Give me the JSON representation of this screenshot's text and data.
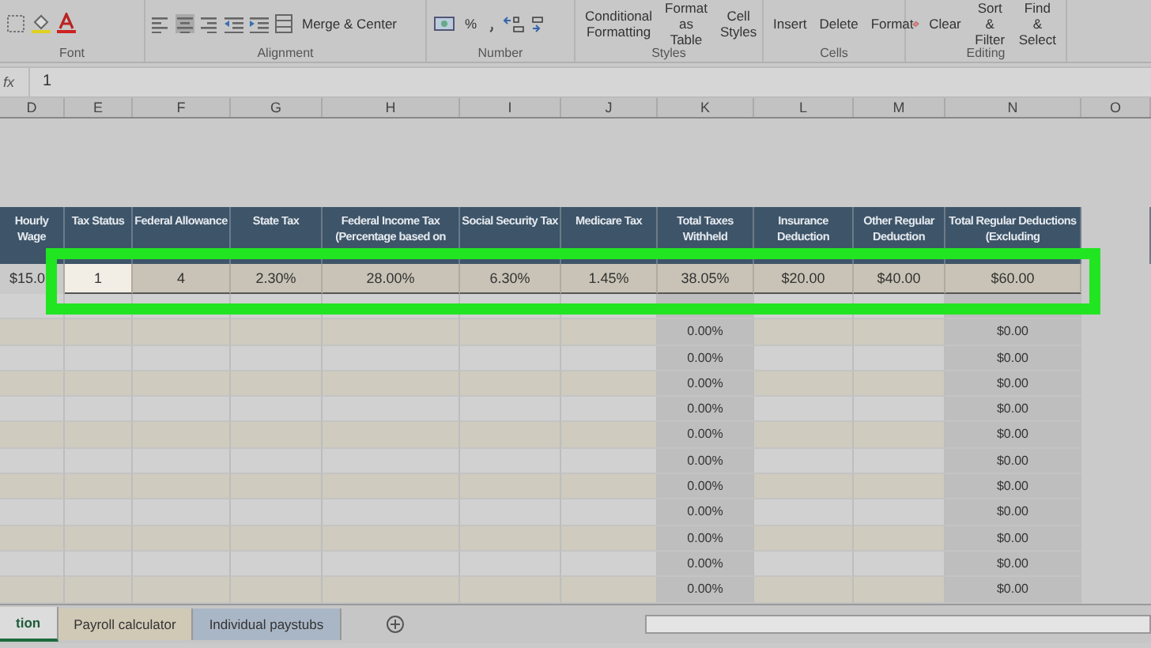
{
  "ribbon": {
    "groups": [
      {
        "kind": "font",
        "label": "Font"
      },
      {
        "kind": "alignment",
        "label": "Alignment",
        "commands": [
          "Merge & Center"
        ]
      },
      {
        "kind": "number",
        "label": "Number",
        "commands": [
          "%"
        ]
      },
      {
        "kind": "styles",
        "label": "Styles",
        "commands": [
          "Conditional Formatting",
          "Format as Table",
          "Cell Styles"
        ]
      },
      {
        "kind": "cells",
        "label": "Cells",
        "commands": [
          "Insert",
          "Delete",
          "Format"
        ]
      },
      {
        "kind": "editing",
        "label": "Editing",
        "commands": [
          "Clear",
          "Sort & Filter",
          "Find & Select"
        ]
      }
    ]
  },
  "formula_bar": {
    "fx": "fx",
    "value": "1"
  },
  "columns": [
    {
      "letter": "D",
      "heading": "Hourly Wage"
    },
    {
      "letter": "E",
      "heading": "Tax Status"
    },
    {
      "letter": "F",
      "heading": "Federal Allowance"
    },
    {
      "letter": "G",
      "heading": "State Tax"
    },
    {
      "letter": "H",
      "heading": "Federal Income Tax (Percentage based on"
    },
    {
      "letter": "I",
      "heading": "Social Security Tax"
    },
    {
      "letter": "J",
      "heading": "Medicare Tax"
    },
    {
      "letter": "K",
      "heading": "Total Taxes Withheld"
    },
    {
      "letter": "L",
      "heading": "Insurance Deduction"
    },
    {
      "letter": "M",
      "heading": "Other Regular Deduction"
    },
    {
      "letter": "N",
      "heading": "Total Regular Deductions (Excluding"
    },
    {
      "letter": "O"
    }
  ],
  "data_row": {
    "cells": [
      {
        "text": "$15.0",
        "selected": false
      },
      {
        "text": "1",
        "selected": true
      },
      {
        "text": "4",
        "selected": false
      },
      {
        "text": "2.30%",
        "selected": false
      },
      {
        "text": "28.00%",
        "selected": false
      },
      {
        "text": "6.30%",
        "selected": false
      },
      {
        "text": "1.45%",
        "selected": false
      },
      {
        "text": "38.05%",
        "selected": false
      },
      {
        "text": "$20.00",
        "selected": false
      },
      {
        "text": "$40.00",
        "selected": false
      },
      {
        "text": "$60.00",
        "selected": false
      }
    ]
  },
  "rows": [
    {
      "K": "0.00%",
      "N": "$0.00"
    },
    {
      "K": "0.00%",
      "N": "$0.00"
    },
    {
      "K": "0.00%",
      "N": "$0.00"
    },
    {
      "K": "0.00%",
      "N": "$0.00"
    },
    {
      "K": "0.00%",
      "N": "$0.00"
    },
    {
      "K": "0.00%",
      "N": "$0.00"
    },
    {
      "K": "0.00%",
      "N": "$0.00"
    },
    {
      "K": "0.00%",
      "N": "$0.00"
    },
    {
      "K": "0.00%",
      "N": "$0.00"
    },
    {
      "K": "0.00%",
      "N": "$0.00"
    },
    {
      "K": "0.00%",
      "N": "$0.00"
    }
  ],
  "sheet_tabs": [
    {
      "label": "tion",
      "selected": true
    },
    {
      "label": "Payroll calculator",
      "selected": false
    },
    {
      "label": "Individual paystubs",
      "selected": false
    }
  ]
}
